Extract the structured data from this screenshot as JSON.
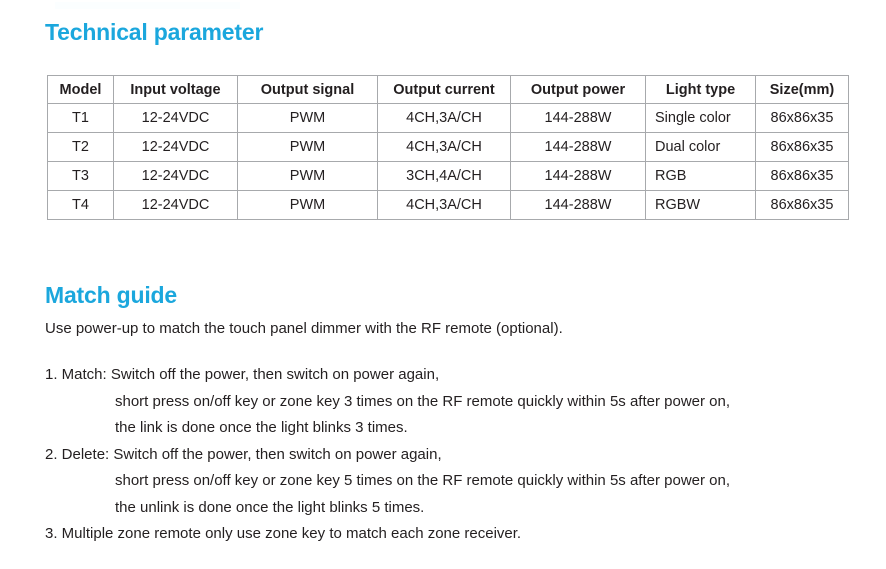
{
  "headings": {
    "technical_parameter": "Technical parameter",
    "match_guide": "Match guide"
  },
  "colors": {
    "heading_blue": "#1ba7dd",
    "text": "#231f20",
    "table_border": "#a7a9ac",
    "background": "#ffffff"
  },
  "spec_table": {
    "columns": [
      "Model",
      "Input voltage",
      "Output signal",
      "Output current",
      "Output power",
      "Light type",
      "Size(mm)"
    ],
    "rows": [
      {
        "model": "T1",
        "input_voltage": "12-24VDC",
        "output_signal": "PWM",
        "output_current": "4CH,3A/CH",
        "output_power": "144-288W",
        "light_type": "Single color",
        "size": "86x86x35"
      },
      {
        "model": "T2",
        "input_voltage": "12-24VDC",
        "output_signal": "PWM",
        "output_current": "4CH,3A/CH",
        "output_power": "144-288W",
        "light_type": "Dual color",
        "size": "86x86x35"
      },
      {
        "model": "T3",
        "input_voltage": "12-24VDC",
        "output_signal": "PWM",
        "output_current": "3CH,4A/CH",
        "output_power": "144-288W",
        "light_type": "RGB",
        "size": "86x86x35"
      },
      {
        "model": "T4",
        "input_voltage": "12-24VDC",
        "output_signal": "PWM",
        "output_current": "4CH,3A/CH",
        "output_power": "144-288W",
        "light_type": "RGBW",
        "size": "86x86x35"
      }
    ]
  },
  "match_guide": {
    "intro": "Use power-up to match the touch panel dimmer with the RF remote (optional).",
    "steps": [
      {
        "main": "1. Match: Switch off the power, then switch on power again,",
        "sub": [
          "short press on/off key or zone key 3 times on the RF remote quickly within 5s after power on,",
          "the link is done once the light blinks 3 times."
        ]
      },
      {
        "main": "2. Delete: Switch off the power, then switch on power again,",
        "sub": [
          "short press on/off key or zone key 5 times on the RF remote quickly within 5s after power on,",
          "the unlink is done once the light blinks 5 times."
        ]
      },
      {
        "main": "3. Multiple zone remote only use zone key to match each zone receiver.",
        "sub": []
      }
    ]
  }
}
